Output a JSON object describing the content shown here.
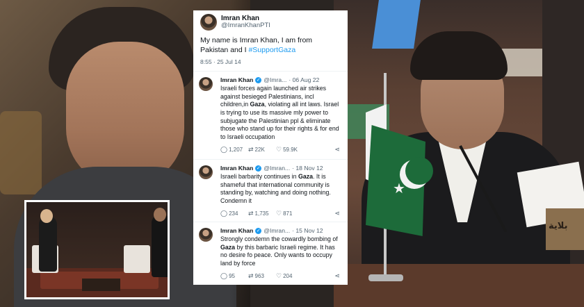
{
  "collage": {
    "plaque_text": "بلاية"
  },
  "main_tweet": {
    "name": "Imran Khan",
    "handle": "@ImranKhanPTI",
    "text_before": "My name is Imran Khan, I am from Pakistan and I ",
    "hashtag": "#SupportGaza",
    "time": "8:55 · 25 Jul 14"
  },
  "tweets": [
    {
      "name": "Imran Khan",
      "handle": "@Imra...",
      "date": "· 06 Aug 22",
      "text_a": "Israeli forces again launched air strikes against besieged Palestinians, incl children,in ",
      "text_bold": "Gaza",
      "text_b": ", violating all int laws. Israel is trying to use its massive mly power to subjugate the Palestinian ppl & eliminate those who stand up for their rights & for end to Israeli occupation",
      "replies": "1,207",
      "retweets": "22K",
      "likes": "59.9K"
    },
    {
      "name": "Imran Khan",
      "handle": "@Imran...",
      "date": "· 18 Nov 12",
      "text_a": "Israeli barbarity continues in ",
      "text_bold": "Gaza",
      "text_b": ". It is shameful that international community is standing by, watching and doing nothing. Condemn it",
      "replies": "234",
      "retweets": "1,735",
      "likes": "871"
    },
    {
      "name": "Imran Khan",
      "handle": "@Imran...",
      "date": "· 15 Nov 12",
      "text_a": "Strongly condemn the cowardly bombing of ",
      "text_bold": "Gaza",
      "text_b": " by this barbaric Israeli regime. It has no desire fo peace. Only wants to occupy land by force",
      "replies": "95",
      "retweets": "963",
      "likes": "204"
    }
  ],
  "icons": {
    "reply": "reply-icon",
    "retweet": "retweet-icon",
    "like": "heart-icon",
    "share": "share-icon",
    "verified": "verified-badge-icon"
  },
  "colors": {
    "link": "#1d9bf0",
    "text": "#0f1419",
    "muted": "#536471",
    "pakistan_green": "#1d6b3a"
  }
}
